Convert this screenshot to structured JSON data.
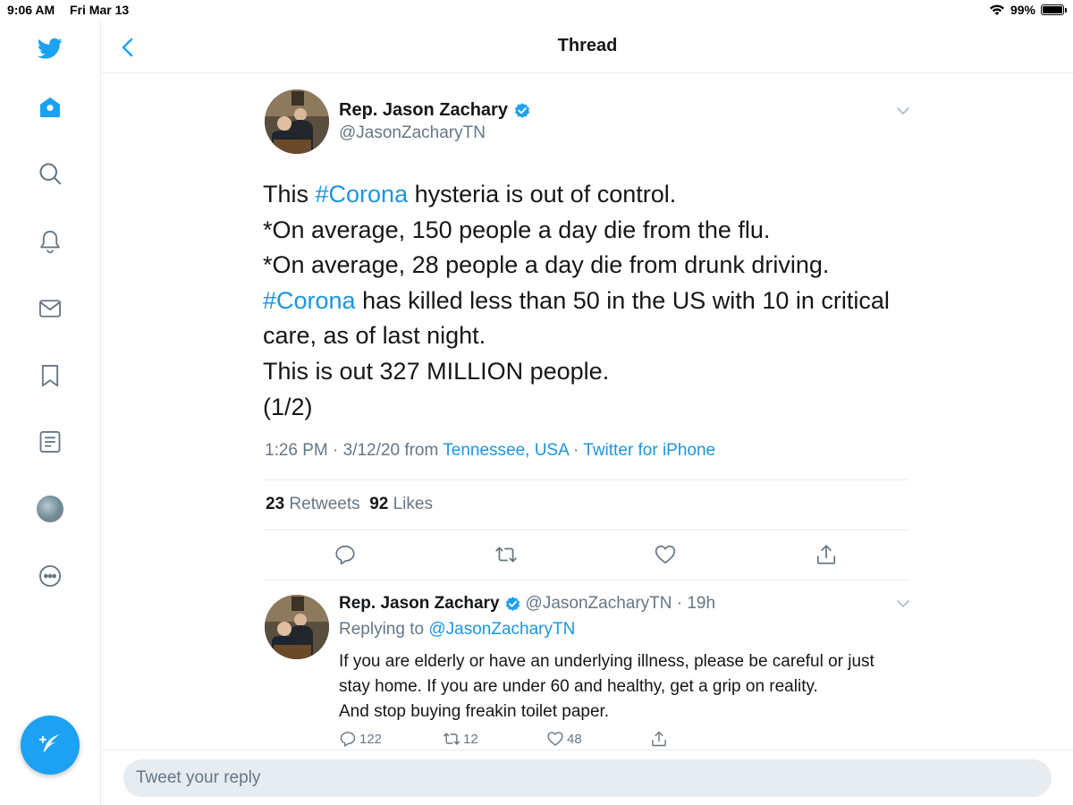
{
  "status_bar": {
    "time": "9:06 AM",
    "date": "Fri Mar 13",
    "battery": "99%"
  },
  "sidebar": {
    "items": [
      {
        "icon": "twitter-logo-icon"
      },
      {
        "icon": "home-icon"
      },
      {
        "icon": "search-icon"
      },
      {
        "icon": "bell-icon"
      },
      {
        "icon": "mail-icon"
      },
      {
        "icon": "bookmark-icon"
      },
      {
        "icon": "lists-icon"
      },
      {
        "icon": "profile-avatar"
      },
      {
        "icon": "more-icon"
      }
    ],
    "compose_icon": "compose-tweet-icon"
  },
  "header": {
    "title": "Thread"
  },
  "main_tweet": {
    "display_name": "Rep. Jason Zachary",
    "handle": "@JasonZacharyTN",
    "text": {
      "l1_pre": "This ",
      "l1_tag": "#Corona",
      "l1_post": " hysteria is out of control.",
      "l2": "*On average, 150 people a day die from the flu.",
      "l3": "*On average, 28 people a day die from drunk driving.",
      "l4_tag": "#Corona",
      "l4_post": " has killed less than 50 in the US with 10 in critical",
      "l5": "care, as of last night.",
      "l6": "This is out 327 MILLION people.",
      "l7": "(1/2)"
    },
    "meta": {
      "time": "1:26 PM · 3/12/20 from ",
      "location": "Tennessee, USA",
      "separator": " · ",
      "source": "Twitter for iPhone"
    },
    "stats": {
      "retweets_count": "23",
      "retweets_label": " Retweets",
      "likes_count": "92",
      "likes_label": " Likes"
    }
  },
  "reply_tweet": {
    "display_name": "Rep. Jason Zachary",
    "handle_time": "@JasonZacharyTN · 19h",
    "replying_label": "Replying to ",
    "replying_to": "@JasonZacharyTN",
    "text": {
      "l1": "If you are elderly or have an underlying illness, please be careful or just",
      "l2": "stay home. If you are under 60 and healthy, get a grip on reality.",
      "l3": "And stop buying freakin toilet paper."
    },
    "replies": "122",
    "retweets": "12",
    "likes": "48"
  },
  "composer": {
    "placeholder": "Tweet your reply"
  },
  "colors": {
    "accent": "#1da1f2",
    "link": "#1b95e0",
    "secondary_text": "#657786",
    "divider": "#e6ecf0"
  }
}
